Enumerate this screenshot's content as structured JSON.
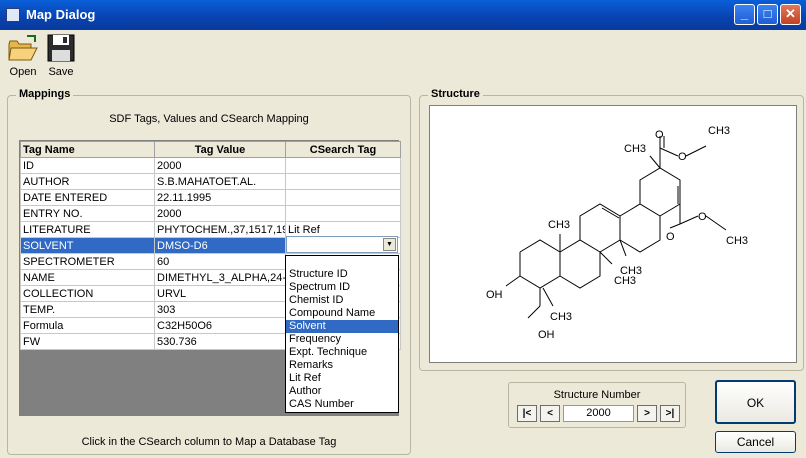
{
  "window": {
    "title": "Map Dialog",
    "min": "_",
    "max": "□",
    "close": "✕"
  },
  "toolbar": {
    "open_label": "Open",
    "save_label": "Save"
  },
  "mappings": {
    "group_title": "Mappings",
    "heading": "SDF Tags, Values and CSearch Mapping",
    "columns": [
      "Tag Name",
      "Tag Value",
      "CSearch Tag"
    ],
    "rows": [
      {
        "tag": "ID",
        "value": "2000",
        "csearch": ""
      },
      {
        "tag": "AUTHOR",
        "value": "S.B.MAHATOET.AL.",
        "csearch": ""
      },
      {
        "tag": "DATE ENTERED",
        "value": "22.11.1995",
        "csearch": ""
      },
      {
        "tag": "ENTRY NO.",
        "value": "2000",
        "csearch": ""
      },
      {
        "tag": "LITERATURE",
        "value": "PHYTOCHEM.,37,1517,19",
        "csearch": "Lit Ref"
      },
      {
        "tag": "SOLVENT",
        "value": "DMSO-D6",
        "csearch": ""
      },
      {
        "tag": "SPECTROMETER",
        "value": "60",
        "csearch": ""
      },
      {
        "tag": "NAME",
        "value": "DIMETHYL_3_ALPHA,24-",
        "csearch": ""
      },
      {
        "tag": "COLLECTION",
        "value": "URVL",
        "csearch": ""
      },
      {
        "tag": "TEMP.",
        "value": "303",
        "csearch": ""
      },
      {
        "tag": "Formula",
        "value": "C32H50O6",
        "csearch": ""
      },
      {
        "tag": "FW",
        "value": "530.736",
        "csearch": ""
      }
    ],
    "dropdown_options": [
      "Structure ID",
      "Spectrum ID",
      "Chemist ID",
      "Compound Name",
      "Solvent",
      "Frequency",
      "Expt. Technique",
      "Remarks",
      "Lit Ref",
      "Author",
      "CAS Number"
    ],
    "dropdown_selected": "Solvent",
    "hint": "Click in the CSearch column to Map a Database Tag"
  },
  "structure": {
    "group_title": "Structure",
    "atoms": {
      "ch3_a": "CH3",
      "ch3_b": "CH3",
      "ch3_c": "CH3",
      "ch3_d": "CH3",
      "ch3_e": "CH3",
      "ch3_f": "CH3",
      "ch3_g": "CH3",
      "o1": "O",
      "o2": "O",
      "o3": "O",
      "o4": "O",
      "oh1": "OH",
      "oh2": "OH"
    }
  },
  "nav": {
    "label": "Structure Number",
    "value": "2000",
    "first": "|<",
    "prev": "<",
    "next": ">",
    "last": ">|"
  },
  "buttons": {
    "ok": "OK",
    "cancel": "Cancel"
  }
}
